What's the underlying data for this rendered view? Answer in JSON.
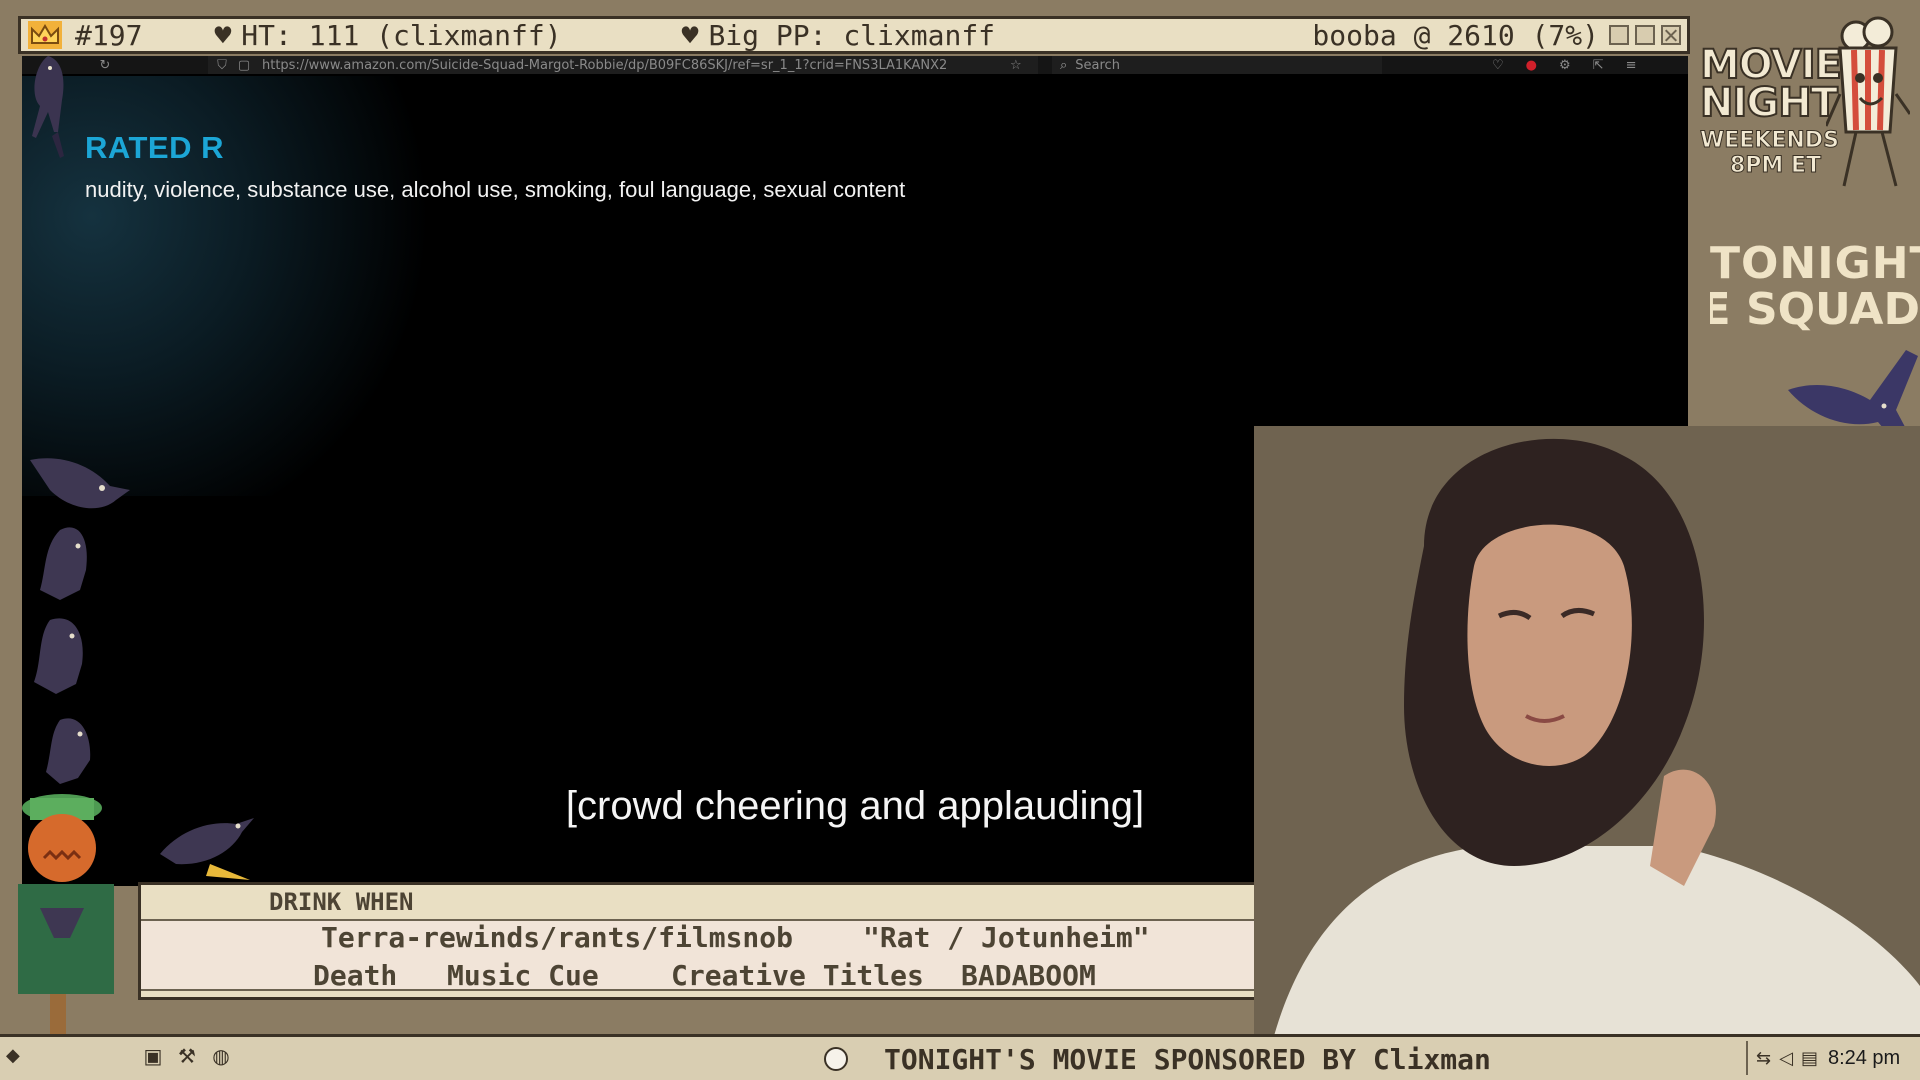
{
  "top_bar": {
    "chat_id": "#197",
    "heart_1": "♥",
    "ht_text": "HT: 111 (clixmanff)",
    "heart_2": "♥",
    "pp_text": "Big PP: clixmanff",
    "booba_text": "booba @ 2610 (7%)"
  },
  "browser": {
    "url": "https://www.amazon.com/Suicide-Squad-Margot-Robbie/dp/B09FC86SKJ/ref=sr_1_1?crid=FNS3LA1KANX2",
    "search_placeholder": "Search"
  },
  "video": {
    "rating": "RATED R",
    "advisory": "nudity, violence, substance use, alcohol use, smoking, foul language, sexual content",
    "subtitle": "[crowd cheering and applauding]"
  },
  "drink_when": {
    "title": "DRINK WHEN",
    "rules": [
      "Terra-rewinds/rants/filmsnob",
      "\"Rat / Jotunheim\"",
      "Death",
      "Music Cue",
      "Creative Titles",
      "BADABOOM"
    ]
  },
  "taskbar": {
    "ticker": "TONIGHT'S MOVIE SPONSORED BY Clixman",
    "clock": "8:24 pm"
  },
  "right_panel": {
    "logo_line_1": "MOVIE",
    "logo_line_2": "NIGHT",
    "logo_line_3": "WEEKENDS",
    "logo_line_4": "8PM ET",
    "tonight_label": "TONIGHT:",
    "tonight_movie": "ICIDE SQUAD"
  },
  "colors": {
    "frame": "#8b7c63",
    "window_chrome": "#e9dfc3",
    "rating_blue": "#1ca6d6"
  }
}
